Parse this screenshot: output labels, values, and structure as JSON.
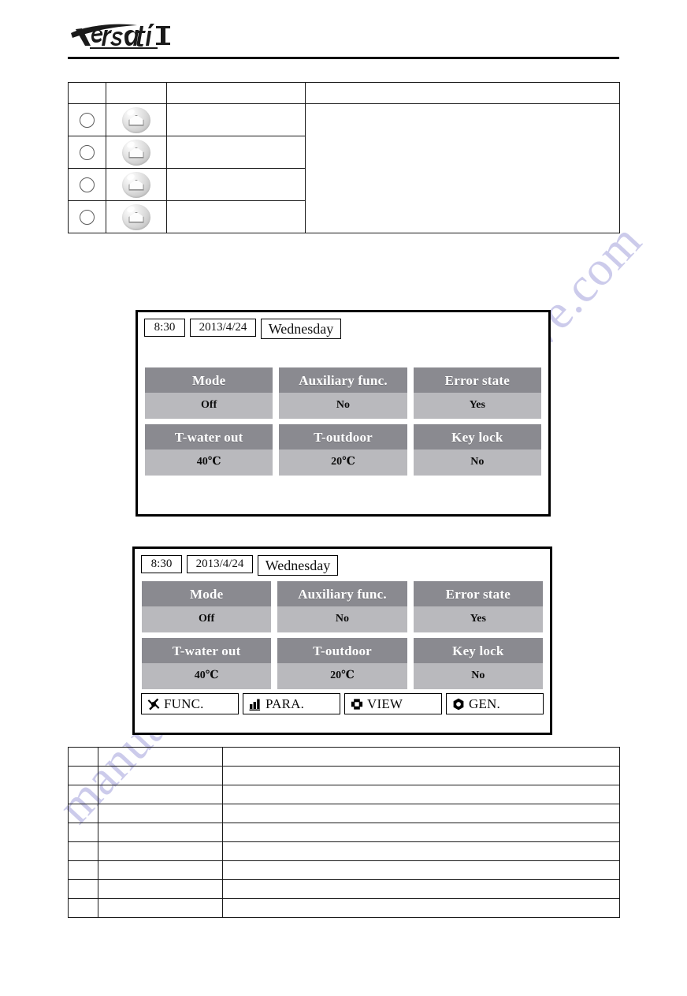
{
  "header": {
    "logo_text": "Versati",
    "logo_mark": "II",
    "logo_name": "versati-ii-logo"
  },
  "top_table": {
    "columns": 4,
    "header_row": [
      "",
      "",
      "",
      ""
    ],
    "rows": [
      {
        "marker": "",
        "icon": "home-button-icon",
        "label": "",
        "note": ""
      },
      {
        "marker": "",
        "icon": "home-button-icon",
        "label": "",
        "note": ""
      },
      {
        "marker": "",
        "icon": "home-button-icon",
        "label": "",
        "note": ""
      },
      {
        "marker": "",
        "icon": "home-button-icon",
        "label": "",
        "note": ""
      }
    ]
  },
  "lcd_1": {
    "status": {
      "time": "8:30",
      "date": "2013/4/24",
      "weekday": "Wednesday"
    },
    "tiles": [
      {
        "title": "Mode",
        "value": "Off"
      },
      {
        "title": "Auxiliary func.",
        "value": "No"
      },
      {
        "title": "Error state",
        "value": "Yes"
      },
      {
        "title": "T-water out",
        "value": "40℃"
      },
      {
        "title": "T-outdoor",
        "value": "20℃"
      },
      {
        "title": "Key lock",
        "value": "No"
      }
    ]
  },
  "lcd_2": {
    "status": {
      "time": "8:30",
      "date": "2013/4/24",
      "weekday": "Wednesday"
    },
    "tiles": [
      {
        "title": "Mode",
        "value": "Off"
      },
      {
        "title": "Auxiliary func.",
        "value": "No"
      },
      {
        "title": "Error state",
        "value": "Yes"
      },
      {
        "title": "T-water out",
        "value": "40℃"
      },
      {
        "title": "T-outdoor",
        "value": "20℃"
      },
      {
        "title": "Key lock",
        "value": "No"
      }
    ],
    "menu": [
      {
        "label": "FUNC.",
        "icon": "wrench-icon"
      },
      {
        "label": "PARA.",
        "icon": "bar-chart-icon"
      },
      {
        "label": "VIEW",
        "icon": "view-cross-icon"
      },
      {
        "label": "GEN.",
        "icon": "hexagon-gear-icon"
      }
    ]
  },
  "bottom_table": {
    "columns": 3,
    "rows": [
      [
        "",
        "",
        ""
      ],
      [
        "",
        "",
        ""
      ],
      [
        "",
        "",
        ""
      ],
      [
        "",
        "",
        ""
      ],
      [
        "",
        "",
        ""
      ],
      [
        "",
        "",
        ""
      ],
      [
        "",
        "",
        ""
      ],
      [
        "",
        "",
        ""
      ],
      [
        "",
        "",
        ""
      ]
    ]
  },
  "watermark": {
    "text_a": "manualshive.com",
    "text_b": "manualshive.com",
    "color": "#b9b8e4"
  },
  "colors": {
    "tile_header": "#8a8a90",
    "tile_value": "#b9b9bd",
    "panel_border": "#000000",
    "page_background": "#ffffff"
  }
}
